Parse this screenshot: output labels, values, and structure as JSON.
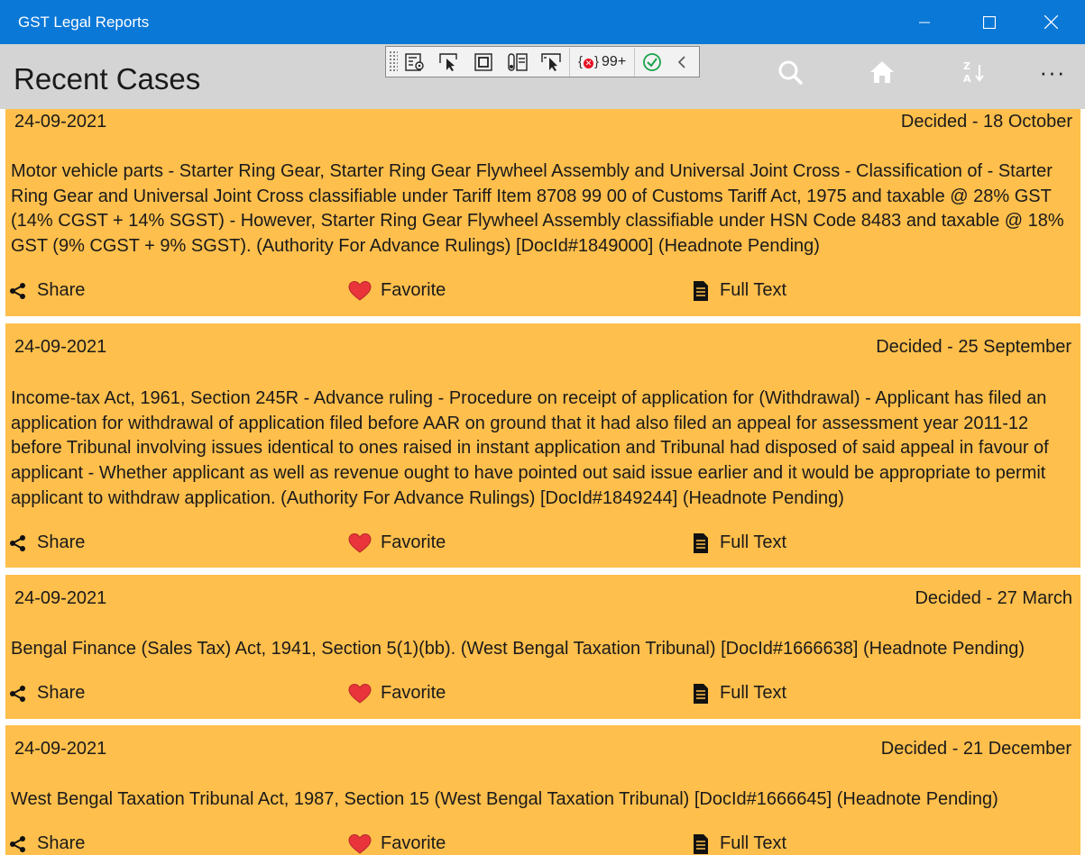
{
  "window": {
    "title": "GST Legal Reports",
    "controls": {
      "minimize": "—",
      "maximize": "☐",
      "close": "✕"
    }
  },
  "header": {
    "title": "Recent Cases",
    "icons": [
      "search-icon",
      "home-icon",
      "sort-z-a-icon",
      "more-icon"
    ],
    "more_label": "···"
  },
  "debug_toolbar": {
    "counter": "99+",
    "icons": [
      "live-visual-tree-icon",
      "select-element-icon",
      "display-layout-adorners-icon",
      "track-focus-icon",
      "preview-selection-icon",
      "binding-failures-icon",
      "hot-reload-status-icon",
      "collapse-icon"
    ]
  },
  "cases": [
    {
      "date": "24-09-2021",
      "status": "Decided - 18 October",
      "text": "Motor vehicle parts - Starter Ring Gear, Starter Ring Gear Flywheel Assembly and Universal Joint Cross - Classification of - Starter Ring Gear and Universal Joint Cross classifiable under Tariff Item 8708 99 00 of Customs Tariff Act, 1975 and taxable @ 28% GST (14% CGST + 14% SGST) - However, Starter Ring Gear Flywheel Assembly classifiable under HSN Code 8483 and taxable @ 18% GST (9% CGST + 9% SGST). (Authority For Advance Rulings) [DocId#1849000] (Headnote Pending)",
      "share": "Share",
      "favorite": "Favorite",
      "fulltext": "Full Text"
    },
    {
      "date": "24-09-2021",
      "status": "Decided - 25 September",
      "text": "Income-tax Act, 1961, Section 245R - Advance ruling - Procedure on receipt of application for (Withdrawal) - Applicant has filed an application for withdrawal of application filed before AAR on ground that it had also filed an appeal for assessment year 2011-12 before Tribunal involving issues identical to ones raised in instant application and Tribunal had disposed of said appeal in favour of applicant - Whether applicant as well as revenue ought to have pointed out said issue earlier and it would be appropriate to permit applicant to withdraw application. (Authority For Advance Rulings) [DocId#1849244] (Headnote Pending)",
      "share": "Share",
      "favorite": "Favorite",
      "fulltext": "Full Text"
    },
    {
      "date": "24-09-2021",
      "status": "Decided - 27 March",
      "text": "Bengal Finance (Sales Tax) Act, 1941, Section 5(1)(bb). (West Bengal Taxation Tribunal) [DocId#1666638] (Headnote Pending)",
      "share": "Share",
      "favorite": "Favorite",
      "fulltext": "Full Text"
    },
    {
      "date": "24-09-2021",
      "status": "Decided - 21 December",
      "text": "West Bengal Taxation Tribunal Act, 1987, Section 15 (West Bengal Taxation Tribunal) [DocId#1666645] (Headnote Pending)",
      "share": "Share",
      "favorite": "Favorite",
      "fulltext": "Full Text"
    }
  ],
  "colors": {
    "titlebar": "#0a78d7",
    "header": "#d4d4d4",
    "card": "#ffbf4c",
    "heart": "#e8343a"
  }
}
